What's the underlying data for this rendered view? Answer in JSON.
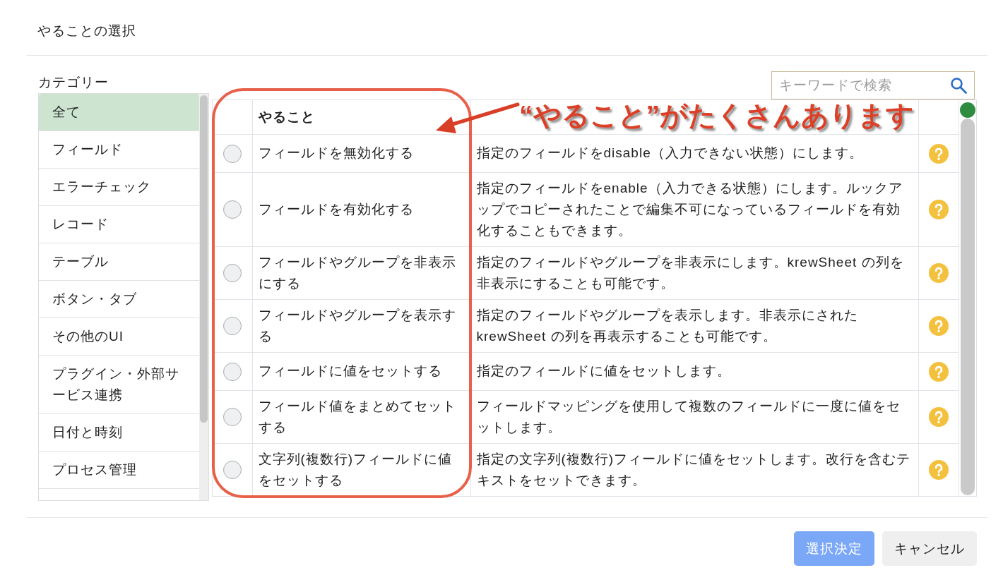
{
  "dialog": {
    "title": "やることの選択"
  },
  "category_panel": {
    "label": "カテゴリー",
    "items": [
      {
        "label": "全て",
        "selected": true
      },
      {
        "label": "フィールド",
        "selected": false
      },
      {
        "label": "エラーチェック",
        "selected": false
      },
      {
        "label": "レコード",
        "selected": false
      },
      {
        "label": "テーブル",
        "selected": false
      },
      {
        "label": "ボタン・タブ",
        "selected": false
      },
      {
        "label": "その他のUI",
        "selected": false
      },
      {
        "label": "プラグイン・外部サービス連携",
        "selected": false
      },
      {
        "label": "日付と時刻",
        "selected": false
      },
      {
        "label": "プロセス管理",
        "selected": false
      }
    ]
  },
  "search": {
    "placeholder": "キーワードで検索"
  },
  "table": {
    "header": "やること",
    "rows": [
      {
        "selected": false,
        "action": "フィールドを無効化する",
        "description": "指定のフィールドをdisable（入力できない状態）にします。"
      },
      {
        "selected": false,
        "action": "フィールドを有効化する",
        "description": "指定のフィールドをenable（入力できる状態）にします。ルックアップでコピーされたことで編集不可になっているフィールドを有効化することもできます。"
      },
      {
        "selected": false,
        "action": "フィールドやグループを非表示にする",
        "description": "指定のフィールドやグループを非表示にします。krewSheet の列を非表示にすることも可能です。"
      },
      {
        "selected": false,
        "action": "フィールドやグループを表示する",
        "description": "指定のフィールドやグループを表示します。非表示にされた krewSheet の列を再表示することも可能です。"
      },
      {
        "selected": false,
        "action": "フィールドに値をセットする",
        "description": "指定のフィールドに値をセットします。"
      },
      {
        "selected": false,
        "action": "フィールド値をまとめてセットする",
        "description": "フィールドマッピングを使用して複数のフィールドに一度に値をセットします。"
      },
      {
        "selected": false,
        "action": "文字列(複数行)フィールドに値をセットする",
        "description": "指定の文字列(複数行)フィールドに値をセットします。改行を含むテキストをセットできます。"
      }
    ]
  },
  "annotation": {
    "text": "“やること”がたくさんあります"
  },
  "buttons": [
    {
      "label": "選択決定",
      "kind": "primary",
      "disabled": true
    },
    {
      "label": "キャンセル",
      "kind": "secondary",
      "disabled": false
    }
  ]
}
